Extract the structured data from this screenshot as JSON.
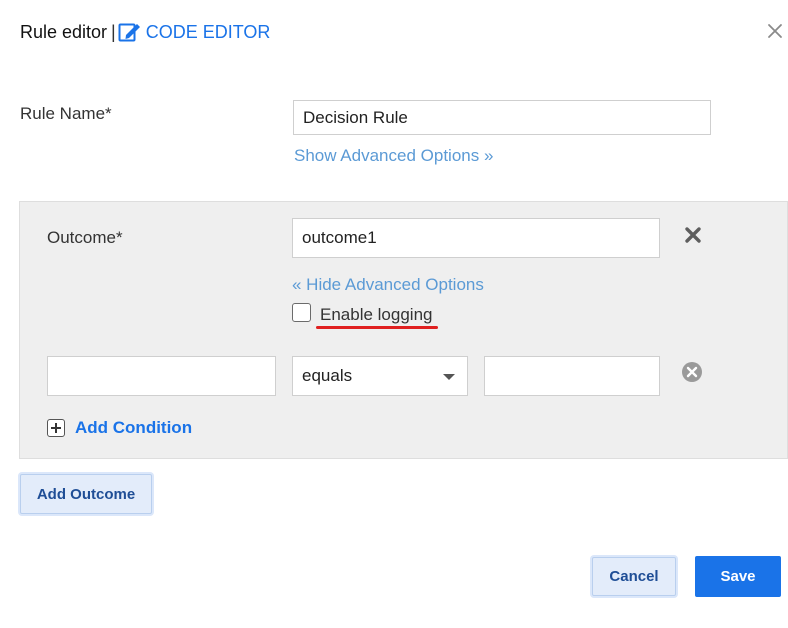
{
  "header": {
    "title": "Rule editor",
    "separator": "|",
    "code_editor_label": "CODE EDITOR"
  },
  "rule_name": {
    "label": "Rule Name*",
    "value": "Decision Rule",
    "show_advanced": "Show Advanced Options »"
  },
  "outcome": {
    "label": "Outcome*",
    "value": "outcome1",
    "hide_advanced": "« Hide Advanced Options",
    "enable_logging_label": "Enable logging",
    "enable_logging_checked": false,
    "condition": {
      "left_value": "",
      "operator": "equals",
      "right_value": ""
    },
    "add_condition_label": "Add Condition"
  },
  "buttons": {
    "add_outcome": "Add Outcome",
    "cancel": "Cancel",
    "save": "Save"
  },
  "colors": {
    "accent": "#1a73e8",
    "link_light": "#5b9ad5",
    "annotation_underline": "#e02020",
    "panel_bg": "#efefef"
  },
  "icons": {
    "code_editor": "edit-icon",
    "close": "close-icon",
    "remove_outcome": "x-icon",
    "remove_condition": "x-circle-icon",
    "add_condition": "plus-square-icon",
    "dropdown": "caret-down-icon"
  }
}
